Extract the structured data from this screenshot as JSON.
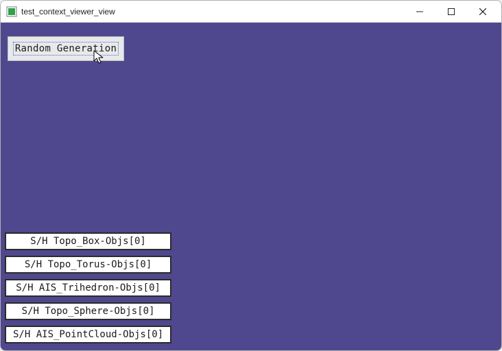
{
  "titlebar": {
    "title": "test_context_viewer_view"
  },
  "buttons": {
    "random_generation": "Random Generation"
  },
  "toggles": [
    {
      "label": "S/H Topo_Box-Objs[0]"
    },
    {
      "label": "S/H Topo_Torus-Objs[0]"
    },
    {
      "label": "S/H AIS_Trihedron-Objs[0]"
    },
    {
      "label": "S/H Topo_Sphere-Objs[0]"
    },
    {
      "label": "S/H AIS_PointCloud-Objs[0]"
    }
  ]
}
